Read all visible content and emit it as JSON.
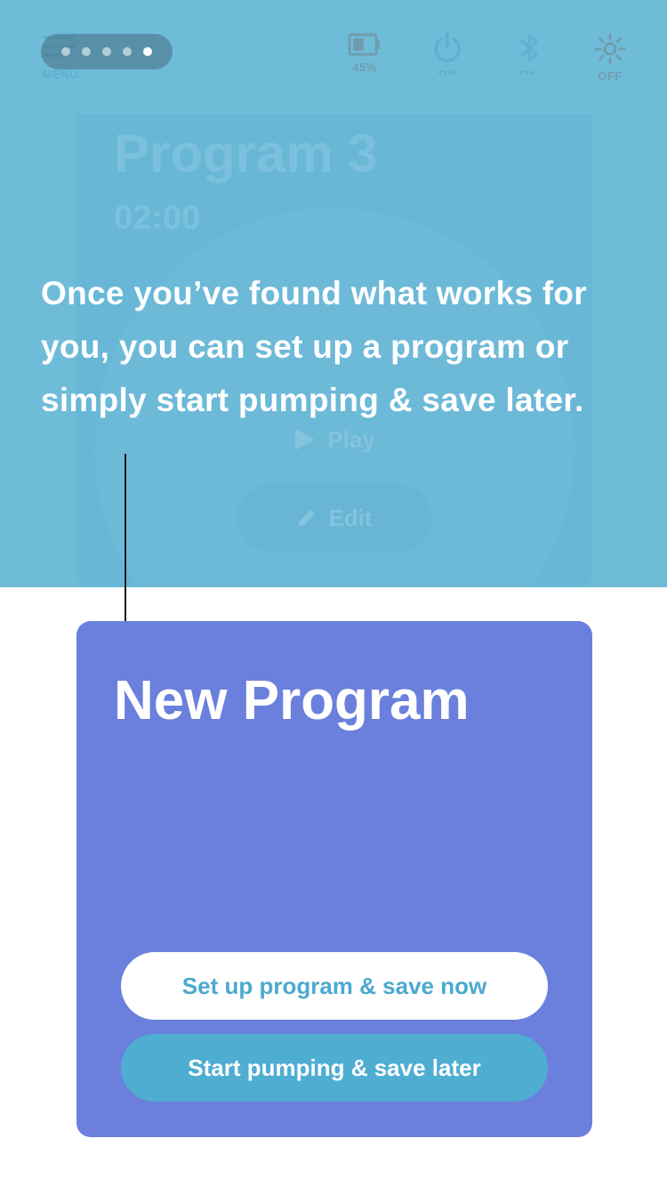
{
  "topbar": {
    "menu_label": "MENU",
    "status": {
      "battery": "45%",
      "power": "ON",
      "bluetooth": "ON",
      "light": "OFF"
    }
  },
  "pager": {
    "total": 5,
    "active_index": 4
  },
  "background_card": {
    "title": "Program 3",
    "time": "02:00",
    "play_label": "Play",
    "edit_label": "Edit"
  },
  "tip": {
    "text": "Once you’ve found what works for you, you can set up a  program or simply start pumping & save later."
  },
  "new_program": {
    "title": "New Program",
    "primary_button": "Set up program & save now",
    "secondary_button": "Start pumping & save later"
  },
  "colors": {
    "app_bg": "#58b3d3",
    "card_purple": "#6a80dc",
    "accent_blue": "#4ca9cf",
    "pointer_dot": "#f29bb4"
  }
}
